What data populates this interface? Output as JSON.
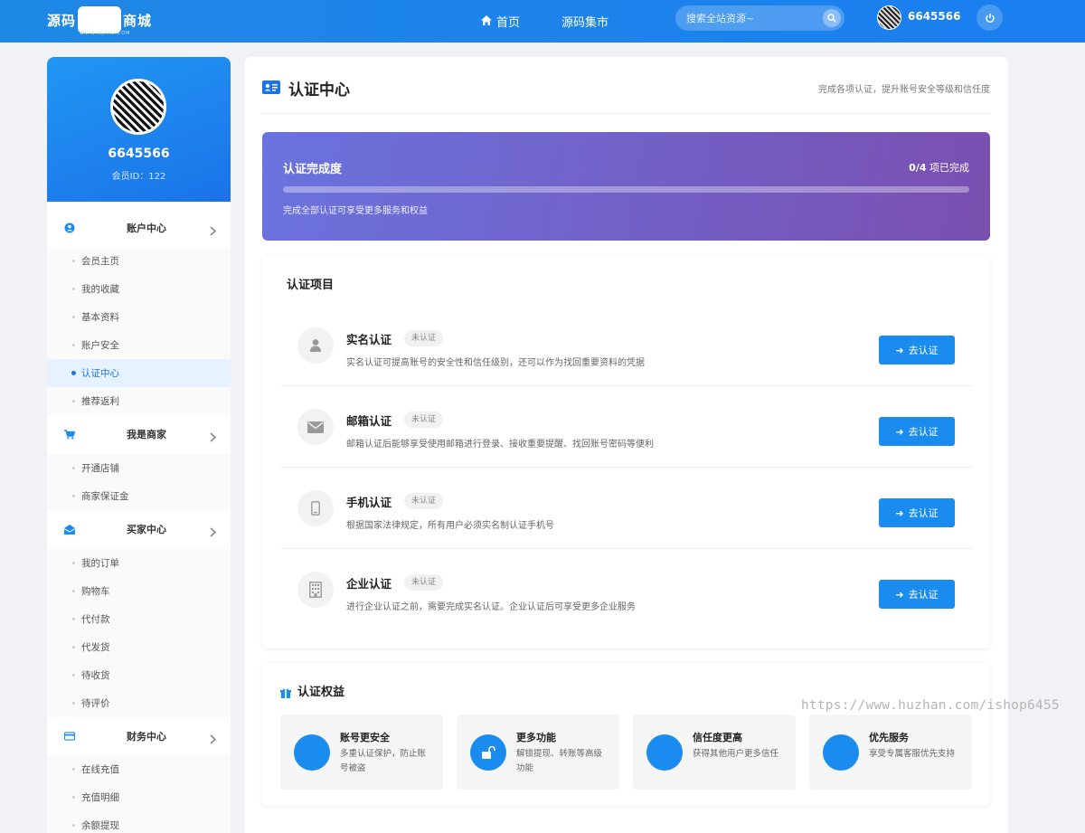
{
  "header": {
    "logo_left": "源码",
    "logo_right": "商城",
    "logo_sub": "WWW.HJPAL.COM",
    "nav": [
      {
        "label": "首页",
        "icon": "home-icon"
      },
      {
        "label": "源码集市"
      }
    ],
    "search_placeholder": "搜索全站资源~",
    "username": "6645566"
  },
  "sidebar": {
    "name": "6645566",
    "member_id": "会员ID：122",
    "groups": [
      {
        "label": "账户中心",
        "icon": "user-circle-icon",
        "items": [
          "会员主页",
          "我的收藏",
          "基本资料",
          "账户安全",
          "认证中心",
          "推荐返利"
        ]
      },
      {
        "label": "我是商家",
        "icon": "cart-icon",
        "items": [
          "开通店铺",
          "商家保证金"
        ]
      },
      {
        "label": "买家中心",
        "icon": "envelope-open-icon",
        "items": [
          "我的订单",
          "购物车",
          "代付款",
          "代发货",
          "待收货",
          "待评价"
        ]
      },
      {
        "label": "财务中心",
        "icon": "credit-card-icon",
        "items": [
          "在线充值",
          "充值明细",
          "余额提现"
        ]
      }
    ],
    "active_item": "认证中心"
  },
  "main": {
    "title": "认证中心",
    "subtitle": "完成各项认证，提升账号安全等级和信任度",
    "progress": {
      "title": "认证完成度",
      "count_strong": "0/4",
      "count_suffix": " 项已完成",
      "completed": 0,
      "total": 4,
      "note": "完成全部认证可享受更多服务和权益"
    },
    "items_title": "认证项目",
    "items": [
      {
        "name": "实名认证",
        "status": "未认证",
        "icon": "user-icon",
        "desc": "实名认证可提高账号的安全性和信任级别，还可以作为找回重要资料的凭据",
        "button": "去认证"
      },
      {
        "name": "邮箱认证",
        "status": "未认证",
        "icon": "envelope-icon",
        "desc": "邮箱认证后能够享受使用邮箱进行登录、接收重要提醒、找回账号密码等便利",
        "button": "去认证"
      },
      {
        "name": "手机认证",
        "status": "未认证",
        "icon": "mobile-icon",
        "desc": "根据国家法律规定，所有用户必须实名制认证手机号",
        "button": "去认证"
      },
      {
        "name": "企业认证",
        "status": "未认证",
        "icon": "building-icon",
        "desc": "进行企业认证之前，需要完成实名认证。企业认证后可享受更多企业服务",
        "button": "去认证"
      }
    ],
    "benefits_title": "认证权益",
    "benefits": [
      {
        "name": "账号更安全",
        "desc": "多重认证保护，防止账号被盗",
        "icon": "shield-icon"
      },
      {
        "name": "更多功能",
        "desc": "解锁提现、转账等高级功能",
        "icon": "unlock-icon"
      },
      {
        "name": "信任度更高",
        "desc": "获得其他用户更多信任",
        "icon": "star-icon"
      },
      {
        "name": "优先服务",
        "desc": "享受专属客服优先支持",
        "icon": "headset-icon"
      }
    ]
  },
  "watermark": "https://www.huzhan.com/ishop6455",
  "colors": {
    "primary": "#1a8cf0",
    "header": "#1e88e5",
    "progress_start": "#6a73de",
    "progress_end": "#7a4fb0"
  }
}
